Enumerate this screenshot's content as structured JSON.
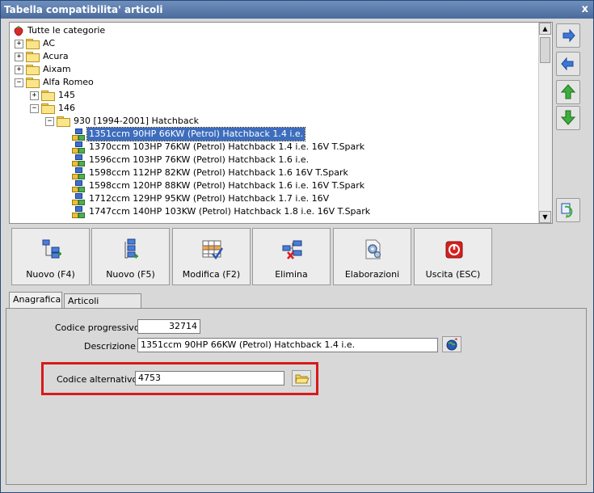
{
  "window": {
    "title": "Tabella compatibilita' articoli",
    "close_glyph": "x"
  },
  "tree": {
    "root_label": "Tutte le categorie",
    "rows": [
      {
        "label": "AC",
        "expander": "+"
      },
      {
        "label": "Acura",
        "expander": "+"
      },
      {
        "label": "Aixam",
        "expander": "+"
      },
      {
        "label": "Alfa Romeo",
        "expander": "−"
      },
      {
        "label": "145",
        "expander": "+"
      },
      {
        "label": "146",
        "expander": "−"
      },
      {
        "label": "930 [1994-2001] Hatchback",
        "expander": "−"
      }
    ],
    "items": [
      "1351ccm 90HP 66KW (Petrol) Hatchback 1.4 i.e.",
      "1370ccm 103HP 76KW (Petrol) Hatchback 1.4 i.e. 16V T.Spark",
      "1596ccm 103HP 76KW (Petrol) Hatchback 1.6 i.e.",
      "1598ccm 112HP 82KW (Petrol) Hatchback 1.6 16V T.Spark",
      "1598ccm 120HP 88KW (Petrol) Hatchback 1.6 i.e. 16V T.Spark",
      "1712ccm 129HP 95KW (Petrol) Hatchback 1.7 i.e. 16V",
      "1747ccm 140HP 103KW (Petrol) Hatchback 1.8 i.e. 16V T.Spark"
    ],
    "selected_index": 0
  },
  "toolbar": {
    "nuovo_f4": "Nuovo (F4)",
    "nuovo_f5": "Nuovo (F5)",
    "modifica": "Modifica (F2)",
    "elimina": "Elimina",
    "elaborazioni": "Elaborazioni",
    "uscita": "Uscita (ESC)"
  },
  "tabs": {
    "anagrafica": "Anagrafica",
    "articoli_collegati": "Articoli collegati"
  },
  "form": {
    "codice_progressivo_label": "Codice progressivo :",
    "codice_progressivo_value": "32714",
    "descrizione_label": "Descrizione :",
    "descrizione_value": "1351ccm 90HP 66KW (Petrol) Hatchback 1.4 i.e.",
    "codice_alternativo_label": "Codice alternativo :",
    "codice_alternativo_value": "4753"
  },
  "colors": {
    "selection": "#3d6dbd",
    "highlight_frame": "#d71a1a",
    "arrow_blue": "#3a78d8",
    "arrow_green": "#3cae3c"
  }
}
